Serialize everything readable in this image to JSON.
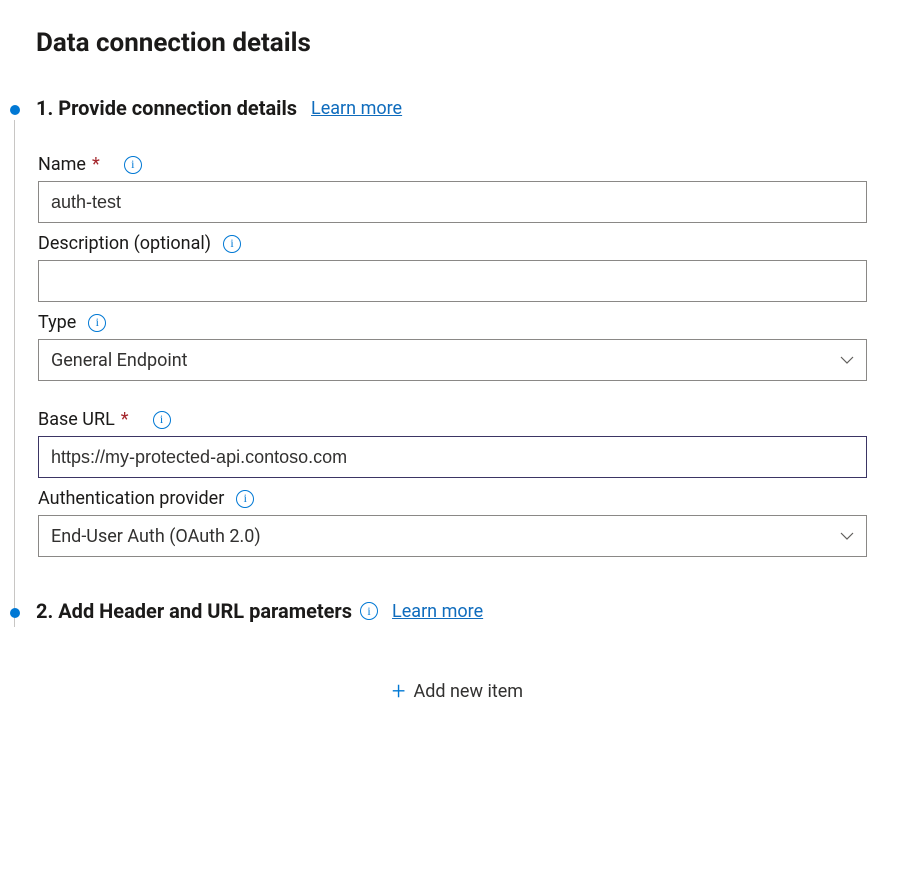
{
  "pageTitle": "Data connection details",
  "step1": {
    "title": "1. Provide connection details",
    "learn": "Learn more",
    "name": {
      "label": "Name",
      "required": "*",
      "value": "auth-test"
    },
    "description": {
      "label": "Description (optional)",
      "value": ""
    },
    "type": {
      "label": "Type",
      "value": "General Endpoint"
    },
    "baseUrl": {
      "label": "Base URL",
      "required": "*",
      "value": "https://my-protected-api.contoso.com"
    },
    "authProvider": {
      "label": "Authentication provider",
      "value": "End-User Auth (OAuth 2.0)"
    }
  },
  "step2": {
    "title": "2. Add Header and URL parameters",
    "learn": "Learn more",
    "addItem": "Add new item"
  }
}
